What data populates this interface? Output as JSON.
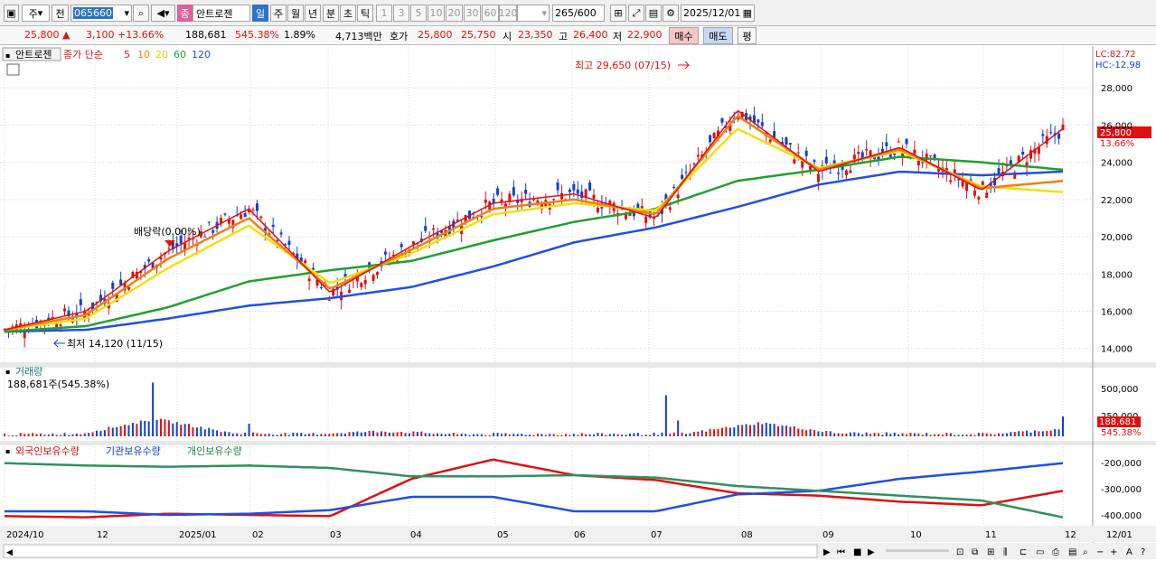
{
  "toolbar": {
    "type_sel": "주",
    "prev": "전",
    "code": "065660",
    "name_badge": "종",
    "name": "안트로젠",
    "periods": [
      "일",
      "주",
      "월",
      "년",
      "분",
      "초",
      "틱"
    ],
    "nums": [
      "1",
      "3",
      "5",
      "10",
      "20",
      "30",
      "60",
      "120"
    ],
    "count": "265",
    "count_total": "/600",
    "date": "2025/12/01"
  },
  "info": {
    "price": "25,800 ▲",
    "change": "3,100 +13.66%",
    "volume": "188,681",
    "vol_ratio": "545.38%",
    "turnover": "1.89%",
    "amount": "4,713백만",
    "quote_label": "호가",
    "ask": "25,800",
    "bid": "25,750",
    "open_label": "시",
    "open": "23,350",
    "high_label": "고",
    "high": "26,400",
    "low_label": "저",
    "low": "22,900",
    "buy": "매수",
    "sell": "매도",
    "avg": "평"
  },
  "price_panel": {
    "name": "안트로젠",
    "ma_prefix": "종가 단순",
    "ma": [
      "5",
      "10",
      "20",
      "60",
      "120"
    ],
    "lc": "LC:82.72",
    "hc": "HC:-12.98",
    "max_label": "최고 29,650 (07/15)",
    "min_label": "최저 14,120 (11/15)",
    "div_label": "배당락(0.00%)",
    "cur_price": "25,800",
    "cur_pct": "13.66%",
    "yticks": [
      "28,000",
      "26,000",
      "24,000",
      "22,000",
      "20,000",
      "18,000",
      "16,000",
      "14,000"
    ]
  },
  "volume_panel": {
    "title": "거래량",
    "value": "188,681주(545.38%)",
    "yticks": [
      "500,000",
      "250,000"
    ],
    "cur": "188,681",
    "cur_pct": "545.38%"
  },
  "holder_panel": {
    "titles": [
      "외국인보유수량",
      "기관보유수량",
      "개인보유수량"
    ],
    "yticks": [
      "-200,000",
      "-300,000",
      "-400,000"
    ]
  },
  "xaxis": [
    "2024/10",
    "12",
    "2025/01",
    "02",
    "03",
    "04",
    "05",
    "06",
    "07",
    "08",
    "09",
    "10",
    "11",
    "12",
    "12/01"
  ],
  "colors": {
    "up": "#e01010",
    "down": "#1040d0",
    "ma5": "#e01010",
    "ma10": "#f08010",
    "ma20": "#f0e010",
    "ma60": "#20a030",
    "ma120": "#2050e0"
  },
  "chart_data": [
    {
      "type": "line",
      "title": "안트로젠",
      "subtitle": "종가 단순 5 10 20 60 120",
      "ylim": [
        13500,
        30000
      ],
      "x": [
        "2024/10",
        "2024/12",
        "2025/01",
        "2025/02",
        "2025/03",
        "2025/04",
        "2025/05",
        "2025/06",
        "2025/07",
        "2025/08",
        "2025/09",
        "2025/10",
        "2025/11",
        "2025/12"
      ],
      "series": [
        {
          "name": "5",
          "values": [
            15000,
            16000,
            19200,
            21500,
            17000,
            19500,
            21800,
            22300,
            21000,
            26800,
            23500,
            24800,
            22500,
            25800
          ]
        },
        {
          "name": "10",
          "values": [
            15000,
            15800,
            18800,
            21000,
            17200,
            19300,
            21500,
            22000,
            21200,
            26500,
            23600,
            24700,
            22600,
            23000
          ]
        },
        {
          "name": "20",
          "values": [
            15000,
            15600,
            18300,
            20600,
            17500,
            19100,
            21200,
            21800,
            21400,
            25800,
            23700,
            24600,
            22700,
            22400
          ]
        },
        {
          "name": "60",
          "values": [
            14900,
            15200,
            16200,
            17600,
            18200,
            18700,
            19800,
            20800,
            21500,
            23000,
            23600,
            24300,
            24000,
            23600
          ]
        },
        {
          "name": "120",
          "values": [
            14900,
            15000,
            15600,
            16300,
            16700,
            17300,
            18400,
            19700,
            20500,
            21600,
            22800,
            23500,
            23300,
            23500
          ]
        }
      ]
    },
    {
      "type": "bar",
      "title": "거래량",
      "ylim": [
        0,
        600000
      ],
      "note": "daily volume; notable spikes",
      "values": [
        20000,
        40000,
        510000,
        60000,
        30000,
        120000,
        25000,
        30000,
        30000,
        40000,
        390000,
        60000,
        40000,
        30000,
        188681
      ]
    },
    {
      "type": "line",
      "ylim": [
        -440000,
        -170000
      ],
      "x": [
        "2024/10",
        "2024/12",
        "2025/01",
        "2025/02",
        "2025/03",
        "2025/04",
        "2025/05",
        "2025/06",
        "2025/07",
        "2025/08",
        "2025/09",
        "2025/10",
        "2025/11",
        "2025/12"
      ],
      "series": [
        {
          "name": "외국인보유수량",
          "values": [
            -415000,
            -420000,
            -405000,
            -410000,
            -415000,
            -260000,
            -180000,
            -245000,
            -265000,
            -320000,
            -330000,
            -355000,
            -370000,
            -310000
          ]
        },
        {
          "name": "기관보유수량",
          "values": [
            -395000,
            -395000,
            -410000,
            -405000,
            -390000,
            -335000,
            -335000,
            -395000,
            -395000,
            -325000,
            -310000,
            -260000,
            -230000,
            -195000
          ]
        },
        {
          "name": "개인보유수량",
          "values": [
            -195000,
            -205000,
            -210000,
            -205000,
            -215000,
            -250000,
            -250000,
            -245000,
            -255000,
            -290000,
            -310000,
            -330000,
            -350000,
            -420000
          ]
        }
      ]
    }
  ]
}
